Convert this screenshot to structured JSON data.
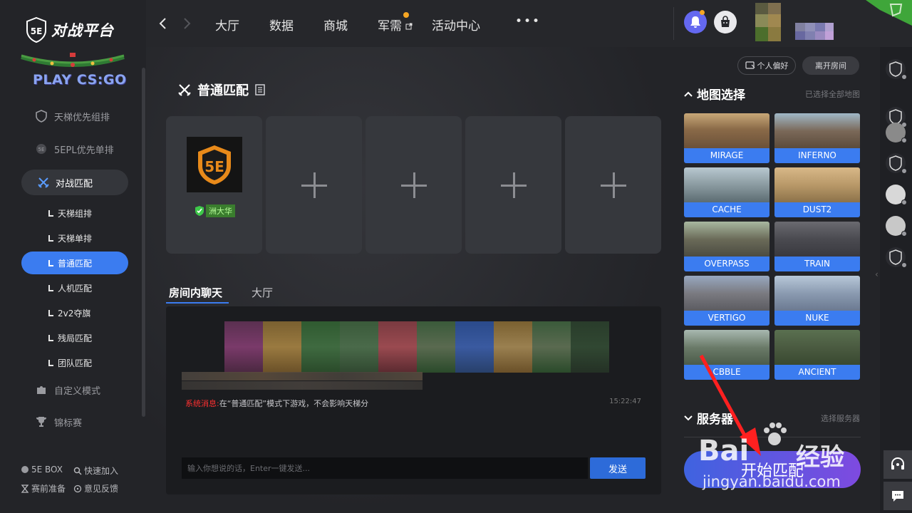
{
  "app": {
    "brand": "对战平台",
    "logo_mark": "5E",
    "game": "PLAY CS:GO"
  },
  "sidebar": {
    "top_items": [
      {
        "label": "天梯优先组排",
        "icon": "shield-icon"
      },
      {
        "label": "5EPL优先单排",
        "icon": "5epl-icon"
      }
    ],
    "active_section": {
      "label": "对战匹配",
      "icon": "crossed-swords-icon"
    },
    "sub_items": [
      {
        "label": "天梯组排"
      },
      {
        "label": "天梯单排"
      },
      {
        "label": "普通匹配",
        "active": true
      },
      {
        "label": "人机匹配"
      },
      {
        "label": "2v2夺旗"
      },
      {
        "label": "残局匹配"
      },
      {
        "label": "团队匹配"
      }
    ],
    "bottom_items": [
      {
        "label": "自定义模式",
        "icon": "puzzle-icon"
      },
      {
        "label": "锦标赛",
        "icon": "trophy-icon"
      }
    ],
    "footer": [
      {
        "label": "5E BOX",
        "icon": "box-icon"
      },
      {
        "label": "快速加入",
        "icon": "search-icon"
      },
      {
        "label": "赛前准备",
        "icon": "hourglass-icon"
      },
      {
        "label": "意见反馈",
        "icon": "feedback-icon"
      }
    ]
  },
  "topbar": {
    "nav": [
      "大厅",
      "数据",
      "商城",
      "军需",
      "活动中心"
    ],
    "more": "•••"
  },
  "main": {
    "match_title": "普通匹配",
    "player": {
      "name": "洲大华",
      "avatar_text": "5E"
    },
    "chat_tabs": [
      "房间内聊天",
      "大厅"
    ],
    "system_label": "系统消息:",
    "system_message": "在“普通匹配”模式下游戏，不会影响天梯分",
    "system_time": "15:22:47",
    "input_placeholder": "输入你想说的话，Enter一键发送...",
    "send_label": "发送"
  },
  "right_panel": {
    "pref_label": "个人偏好",
    "leave_label": "离开房间",
    "map_section_title": "地图选择",
    "map_section_note": "已选择全部地图",
    "maps": [
      {
        "name": "MIRAGE"
      },
      {
        "name": "INFERNO"
      },
      {
        "name": "CACHE"
      },
      {
        "name": "DUST2"
      },
      {
        "name": "OVERPASS"
      },
      {
        "name": "TRAIN"
      },
      {
        "name": "VERTIGO"
      },
      {
        "name": "NUKE"
      },
      {
        "name": "CBBLE"
      },
      {
        "name": "ANCIENT"
      }
    ],
    "server_section_title": "服务器",
    "server_section_note": "选择服务器",
    "start_label": "开始匹配"
  },
  "watermark": {
    "brand": "Bai",
    "brand_cn": "经验",
    "url": "jingyan.baidu.com"
  },
  "colors": {
    "accent": "#3b7cf0",
    "danger": "#ff3030",
    "start_gradient_end": "#7e4ae0"
  }
}
